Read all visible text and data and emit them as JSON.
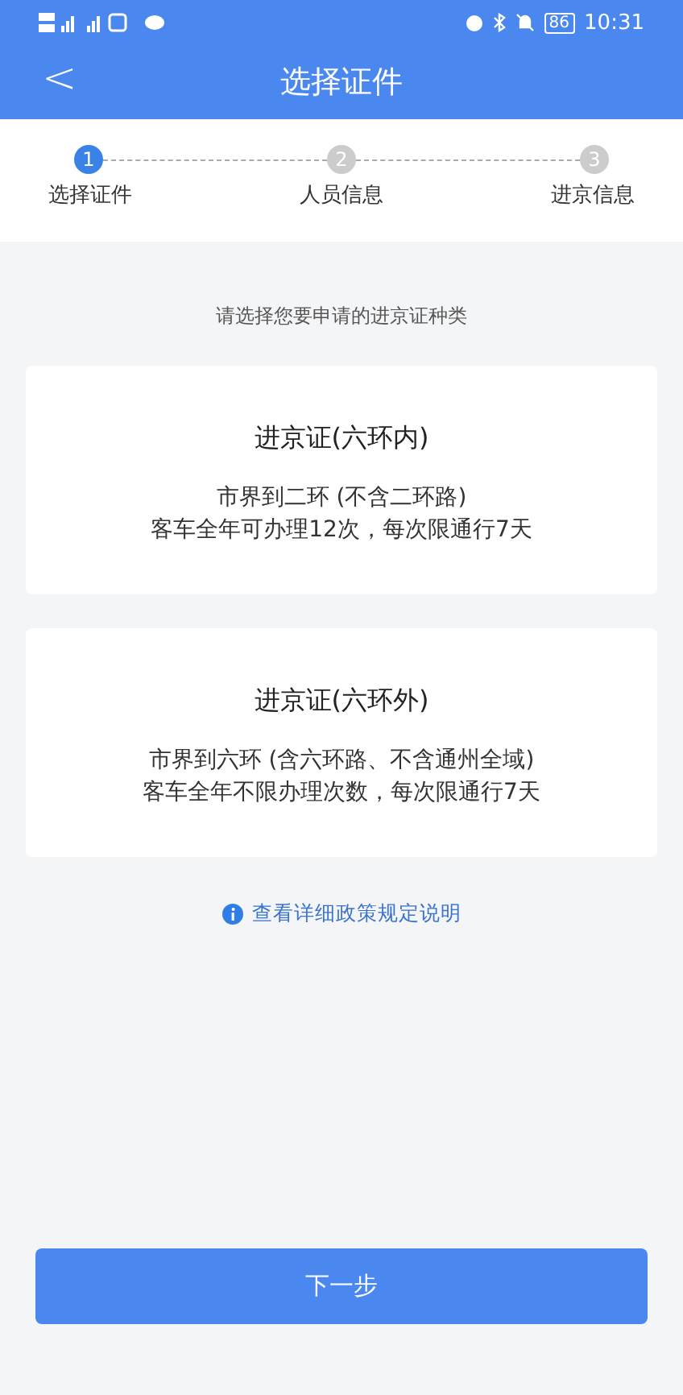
{
  "status_bar": {
    "battery": "86",
    "time": "10:31"
  },
  "header": {
    "back": "<",
    "title": "选择证件"
  },
  "steps": [
    {
      "number": "1",
      "label": "选择证件",
      "selected": true
    },
    {
      "number": "2",
      "label": "人员信息",
      "selected": false
    },
    {
      "number": "3",
      "label": "进京信息",
      "selected": false
    }
  ],
  "prompt": "请选择您要申请的进京证种类",
  "options": [
    {
      "title": "进京证(六环内)",
      "lines": [
        "市界到二环 (不含二环路)",
        "客车全年可办理12次，每次限通行7天"
      ]
    },
    {
      "title": "进京证(六环外)",
      "lines": [
        "市界到六环 (含六环路、不含通州全域)",
        "客车全年不限办理次数，每次限通行7天"
      ]
    }
  ],
  "policy_link": "查看详细政策规定说明",
  "next_button": "下一步"
}
